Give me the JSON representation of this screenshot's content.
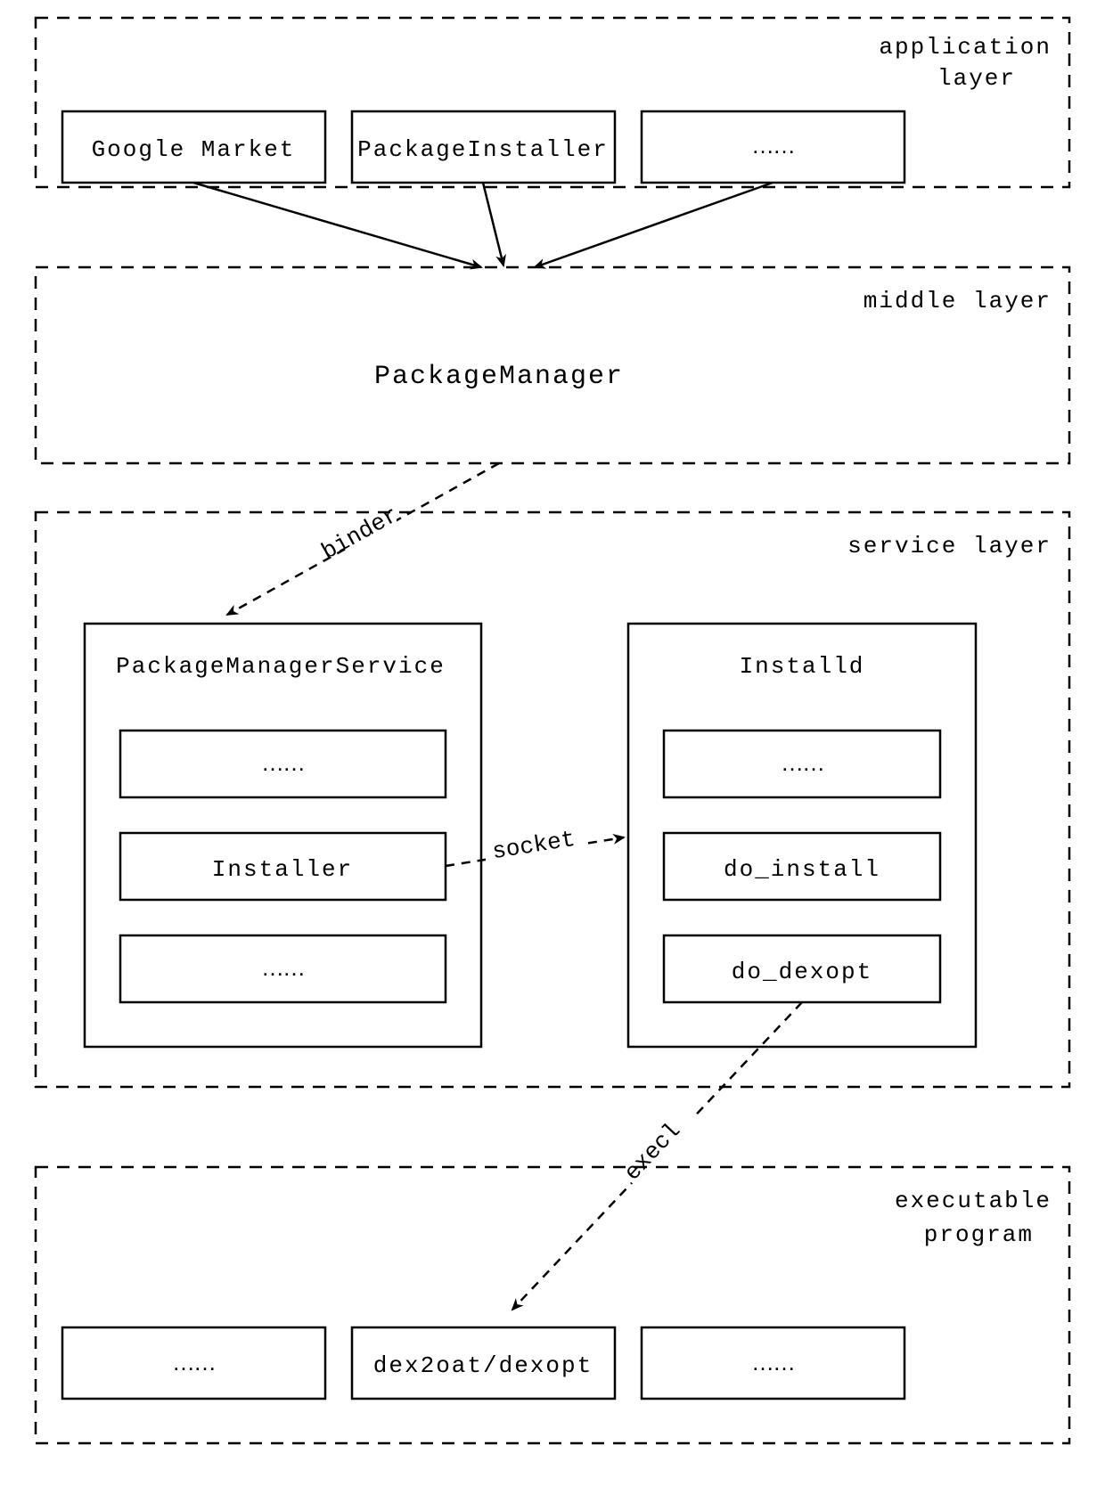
{
  "layers": {
    "application": {
      "title_line1": "application",
      "title_line2": "layer",
      "boxes": [
        "Google Market",
        "PackageInstaller",
        "……"
      ]
    },
    "middle": {
      "title": "middle layer",
      "content": "PackageManager"
    },
    "service": {
      "title": "service layer",
      "left": {
        "title": "PackageManagerService",
        "items": [
          "……",
          "Installer",
          "……"
        ]
      },
      "right": {
        "title": "Installd",
        "items": [
          "……",
          "do_install",
          "do_dexopt"
        ]
      }
    },
    "executable": {
      "title_line1": "executable",
      "title_line2": "program",
      "boxes": [
        "……",
        "dex2oat/dexopt",
        "……"
      ]
    }
  },
  "edges": {
    "binder": "binder",
    "socket": "socket",
    "execl": "execl"
  }
}
